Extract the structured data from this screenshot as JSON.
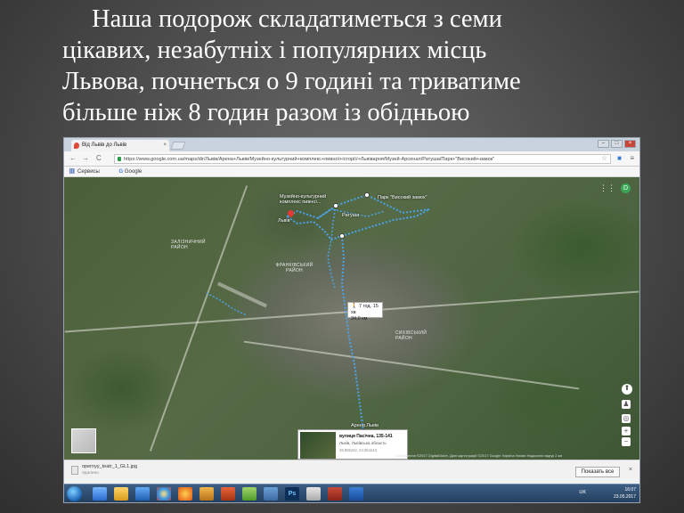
{
  "slide": {
    "lines": [
      "Наша подорож складатиметься з семи",
      "цікавих, незабутніх і популярних місць",
      "Львова, почнеться о 9 годині та триватиме",
      "більше ніж 8 годин разом із обідньою"
    ]
  },
  "browser": {
    "tab_title": "Від Львів до Львів",
    "tab_close": "×",
    "window_buttons": [
      "–",
      "□",
      "×"
    ],
    "nav": {
      "back": "←",
      "forward": "→",
      "reload": "C"
    },
    "url": "https://www.google.com.ua/maps/dir/Львів/Арена+Львів/Музейно-культурний+комплекс+пивної+історії/+Львіварня/Музей-Арсенал/Ратуша/Парк+\"Високий+замок\"",
    "bookmarks": {
      "apps_label": "Сервисы",
      "google_label": "Google"
    }
  },
  "map": {
    "labels": {
      "museum": "Музейно-культурний комплекс пивної...",
      "park": "Парк \"Високий замок\"",
      "ratusha": "Ратуша",
      "lviv": "Львів",
      "district_frankivskyi": "ФРАНКІВСЬКИЙ РАЙОН",
      "district_zaliznychnyi": "ЗАЛІЗНИЧНИЙ РАЙОН",
      "district_sykhivskyi": "СИХІВСЬКИЙ РАЙОН",
      "arena": "Арена Львів"
    },
    "route": {
      "duration": "7 год. 15 хв",
      "distance": "34,0 км"
    },
    "place_card": {
      "title": "вулиця Пасічна, 135-141",
      "address": "Львів, Львівська область",
      "coords": "49.805442, 24.054443"
    },
    "footer": "Зображення ©2017 DigitalGlobe, Дані картографії ©2017 Google  Україна  Умови  Надіслати відгук  2 км",
    "account_initial": "D"
  },
  "downloads": {
    "file_name": "opernyy_teatr_1_GL1.jpg",
    "file_status": "Удалено",
    "show_all": "Показать все",
    "close": "×"
  },
  "taskbar": {
    "lang": "UK",
    "time": "16:07",
    "date": "23.05.2017"
  },
  "colors": {
    "route": "#4aa3e8",
    "pin": "#e53935",
    "slide_bg": "#4a4a4a",
    "slide_text": "#ffffff"
  }
}
